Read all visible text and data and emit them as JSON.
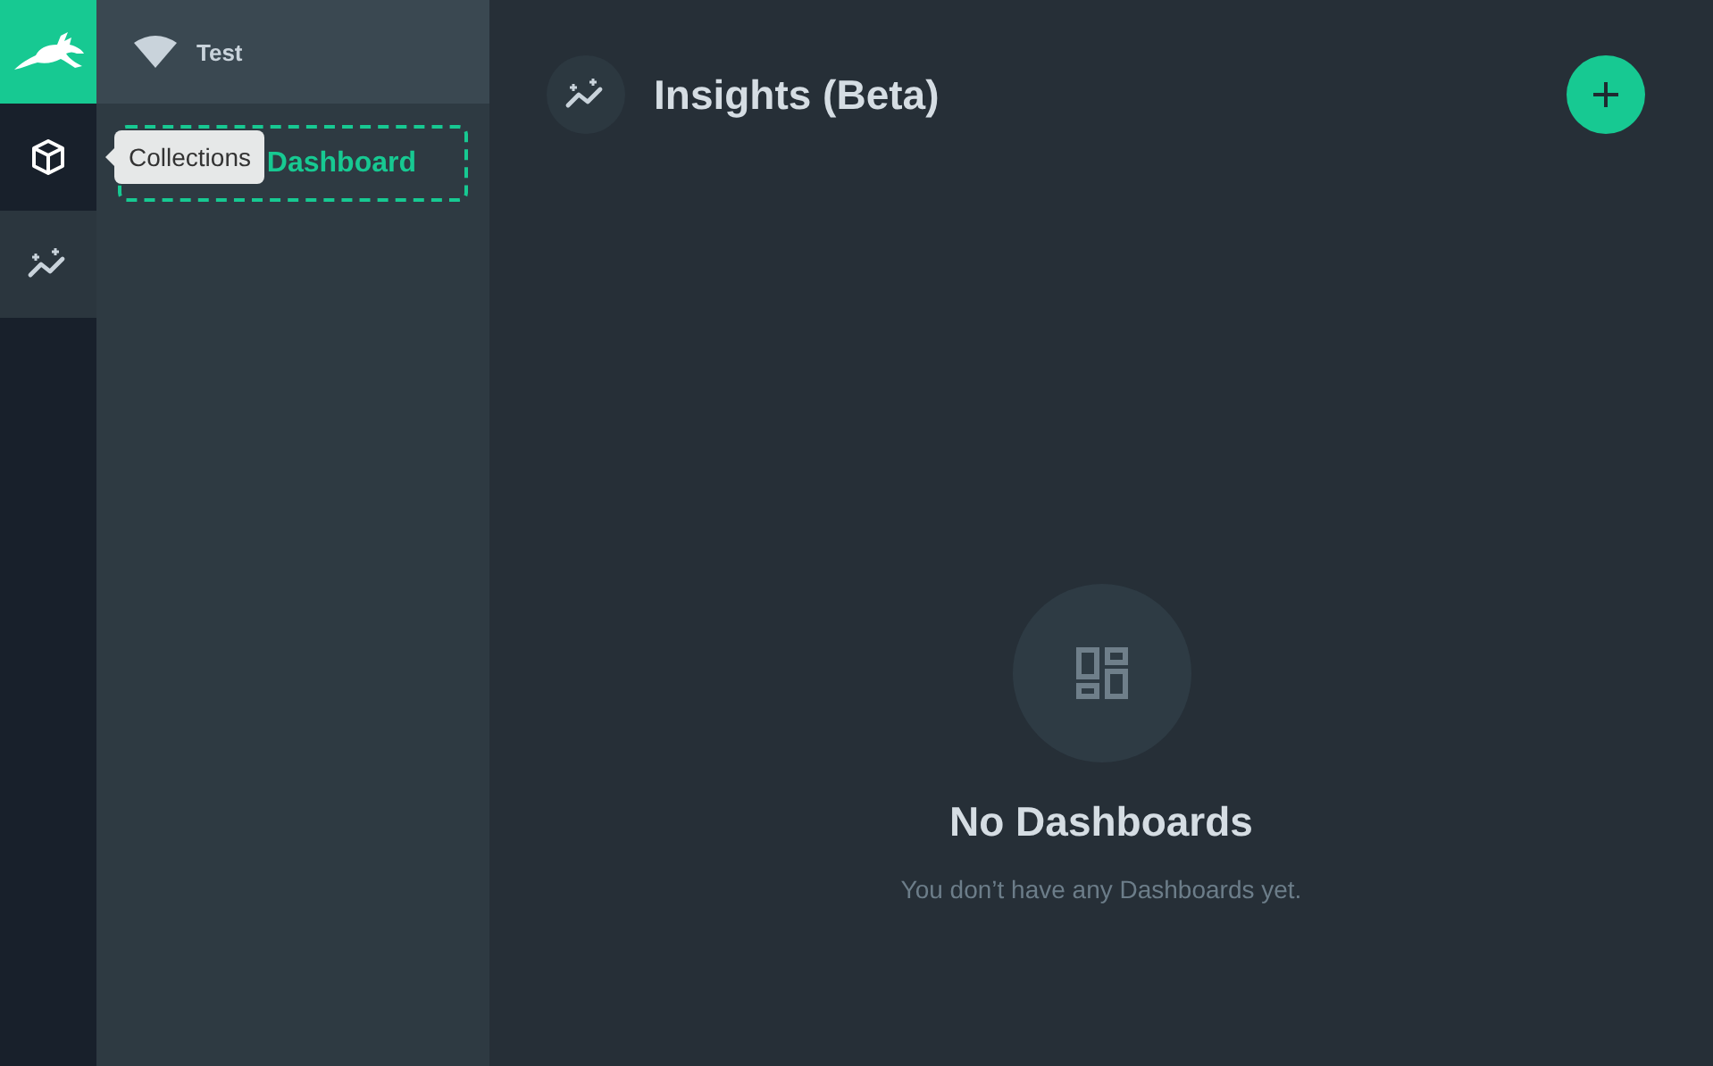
{
  "rail": {
    "items": [
      {
        "selected": false
      },
      {
        "selected": true
      }
    ],
    "tooltip": "Collections"
  },
  "sidebar": {
    "workspace": "Test",
    "create_button": "Dashboard"
  },
  "header": {
    "title": "Insights (Beta)"
  },
  "empty_state": {
    "title": "No Dashboards",
    "message": "You don’t have any Dashboards yet."
  }
}
